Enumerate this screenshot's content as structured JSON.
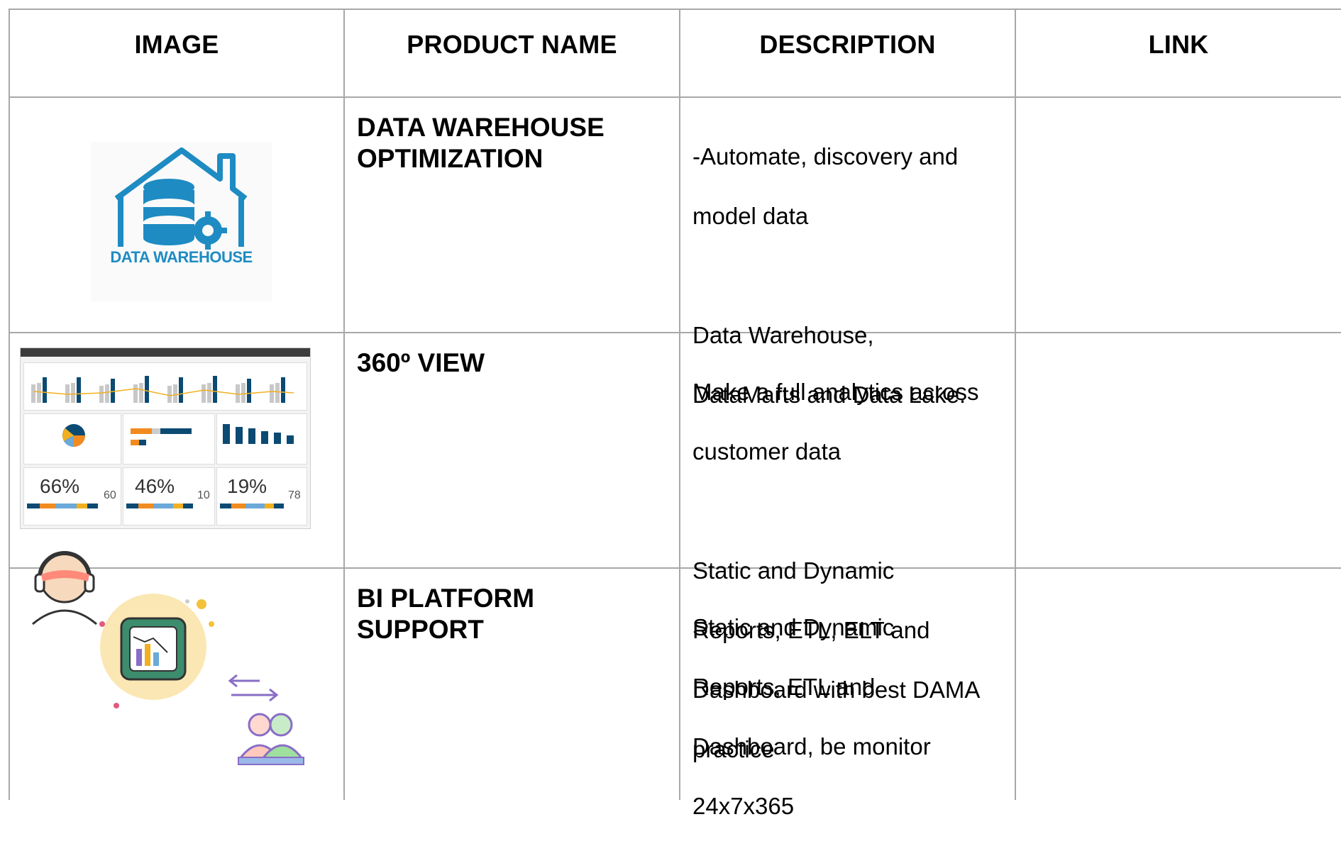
{
  "headers": {
    "image": "IMAGE",
    "product_name": "PRODUCT NAME",
    "description": "DESCRIPTION",
    "link": "LINK"
  },
  "rows": [
    {
      "image_label": "DATA WAREHOUSE",
      "product_name": "DATA WAREHOUSE OPTIMIZATION",
      "description_lines": [
        "-Automate, discovery and",
        "model data",
        "",
        "Data Warehouse,",
        "DataMarts and Data Lake."
      ],
      "link": ""
    },
    {
      "product_name": "360º VIEW",
      "description_lines": [
        "Make a full analytics across",
        "customer data",
        "",
        "Static and Dynamic",
        "Reports, ETL, ELT and",
        "Dashboard with best DAMA",
        "practice"
      ],
      "link": "",
      "dashboard": {
        "kpis": [
          "66%",
          "46%",
          "19%"
        ],
        "counts": [
          "60",
          "10",
          "78"
        ]
      }
    },
    {
      "product_name": "BI PLATFORM SUPPORT",
      "description_lines": [
        "Static and Dynamic",
        "Reports, ETL and",
        "Dashboard, be monitor",
        "24x7x365"
      ],
      "link": ""
    }
  ],
  "colors": {
    "warehouse_blue": "#1e8bc3",
    "grid": "#a8a8a8",
    "dash_navy": "#0b4a73",
    "dash_orange": "#f28b1f"
  }
}
